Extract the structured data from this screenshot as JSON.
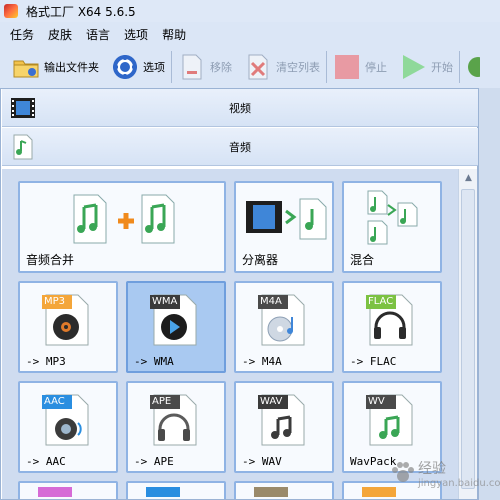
{
  "window": {
    "title": "格式工厂 X64 5.6.5"
  },
  "menu": {
    "items": [
      "任务",
      "皮肤",
      "语言",
      "选项",
      "帮助"
    ]
  },
  "toolbar": {
    "output_folder": "输出文件夹",
    "options": "选项",
    "remove": "移除",
    "clear_list": "清空列表",
    "stop": "停止",
    "start": "开始"
  },
  "categories": {
    "video": "视频",
    "audio": "音频"
  },
  "tiles": [
    {
      "label": "音频合并",
      "badge": ""
    },
    {
      "label": "分离器",
      "badge": ""
    },
    {
      "label": "混合",
      "badge": ""
    },
    {
      "label": "-> MP3",
      "badge": "MP3",
      "color": "#f4a63a"
    },
    {
      "label": "-> WMA",
      "badge": "WMA",
      "color": "#3b3b3b"
    },
    {
      "label": "-> M4A",
      "badge": "M4A",
      "color": "#4a4a4a"
    },
    {
      "label": "-> FLAC",
      "badge": "FLAC",
      "color": "#7cc242"
    },
    {
      "label": "-> AAC",
      "badge": "AAC",
      "color": "#2a8ee0"
    },
    {
      "label": "-> APE",
      "badge": "APE",
      "color": "#4a4a4a"
    },
    {
      "label": "-> WAV",
      "badge": "WAV",
      "color": "#3b3b3b"
    },
    {
      "label": "WavPack",
      "badge": "WV",
      "color": "#4a4a4a"
    }
  ],
  "watermark": {
    "text": "经验",
    "sub": "jingyan.baidu.com"
  },
  "colors": {
    "accent": "#8fb3e4",
    "selected": "#a9c9f1",
    "pane": "#cfdcf0"
  }
}
